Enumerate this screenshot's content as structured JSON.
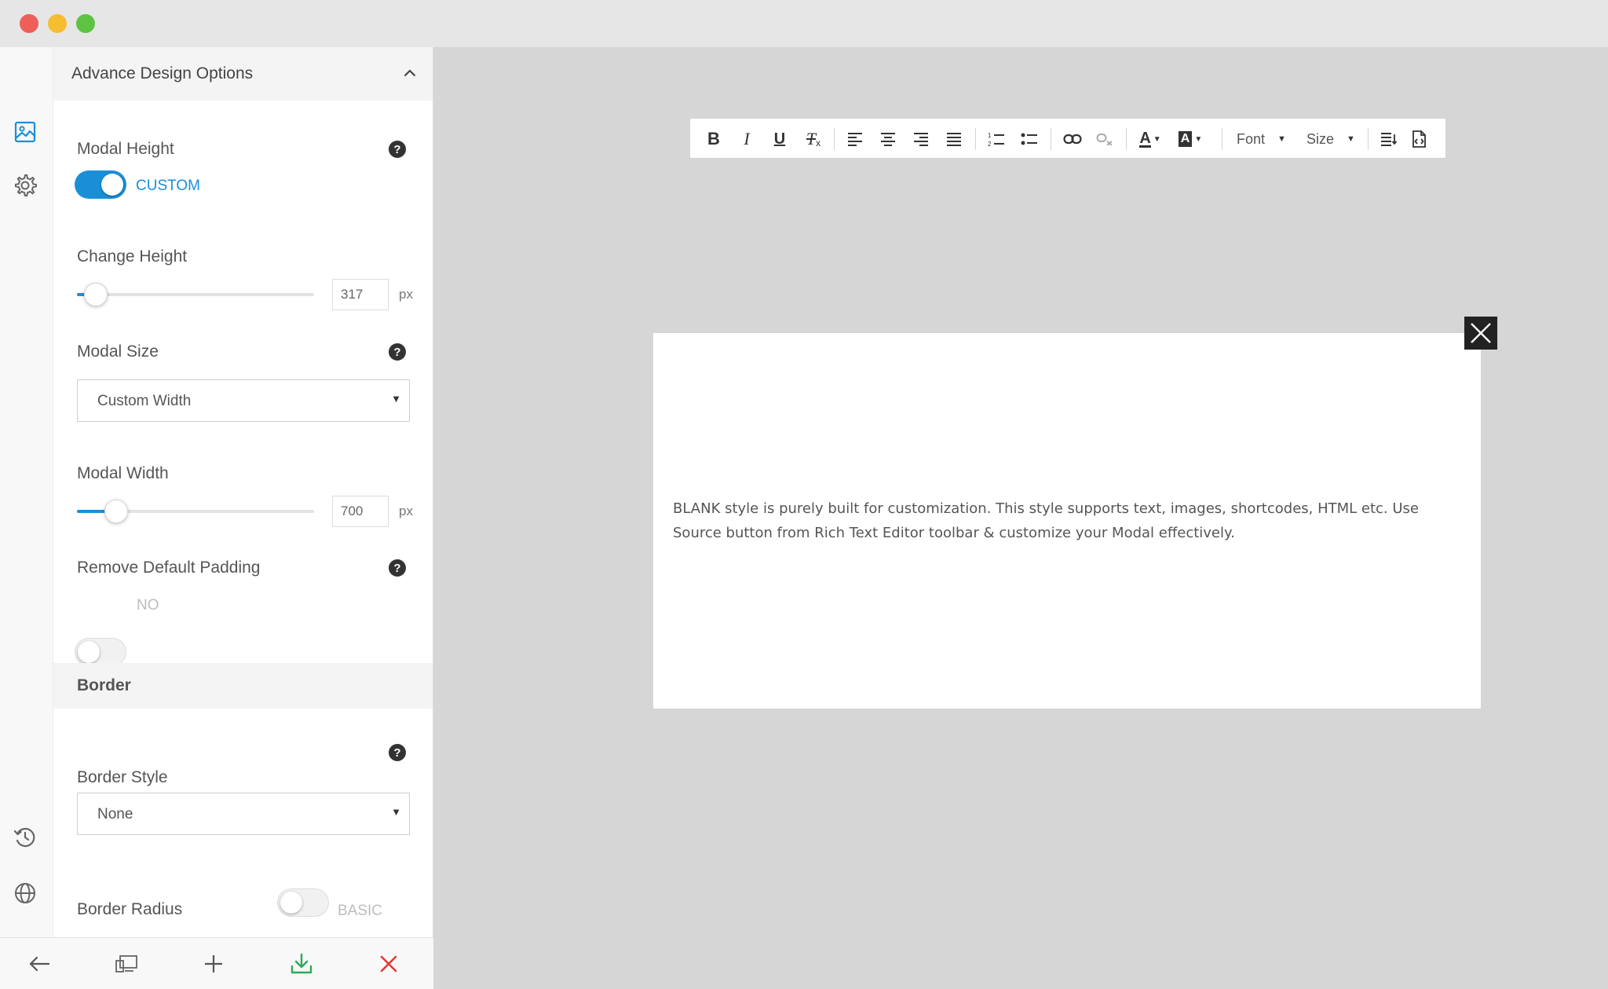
{
  "panel": {
    "header_title": "Advance Design Options",
    "modal_height": {
      "label": "Modal Height",
      "help": "?",
      "toggle_on": true,
      "toggle_text": "CUSTOM"
    },
    "change_height": {
      "label": "Change Height",
      "value": "317",
      "unit": "px",
      "slider_fraction": 0.08
    },
    "modal_size": {
      "label": "Modal Size",
      "help": "?",
      "selected": "Custom Width"
    },
    "modal_width": {
      "label": "Modal Width",
      "value": "700",
      "unit": "px",
      "slider_fraction": 0.165
    },
    "remove_padding": {
      "label": "Remove Default Padding",
      "help": "?",
      "toggle_on": false,
      "toggle_text": "NO"
    },
    "border_section": "Border",
    "border_style": {
      "label": "Border Style",
      "help": "?",
      "selected": "None"
    },
    "border_radius": {
      "label": "Border Radius",
      "toggle_on": false,
      "toggle_text": "BASIC"
    }
  },
  "rail_icons": [
    "image-icon",
    "gear-icon",
    "history-icon",
    "globe-icon"
  ],
  "bottom_bar": [
    "back-arrow-icon",
    "device-preview-icon",
    "plus-icon",
    "download-icon",
    "close-icon"
  ],
  "editor_toolbar": {
    "buttons": [
      "bold",
      "italic",
      "underline",
      "remove-format",
      "align-left",
      "align-center",
      "align-right",
      "align-justify",
      "numbered-list",
      "bulleted-list",
      "link",
      "unlink",
      "text-color",
      "background-color",
      "block-format",
      "source"
    ],
    "font_label": "Font",
    "size_label": "Size"
  },
  "modal": {
    "body_text_line1": "BLANK style is purely built for customization. This style supports text, images, shortcodes, HTML etc. Use",
    "body_text_line2": "Source button from Rich Text Editor toolbar & customize your Modal effectively."
  },
  "colors": {
    "accent": "#1a8fd8",
    "download_green": "#2eaa57",
    "close_red": "#e53935"
  }
}
